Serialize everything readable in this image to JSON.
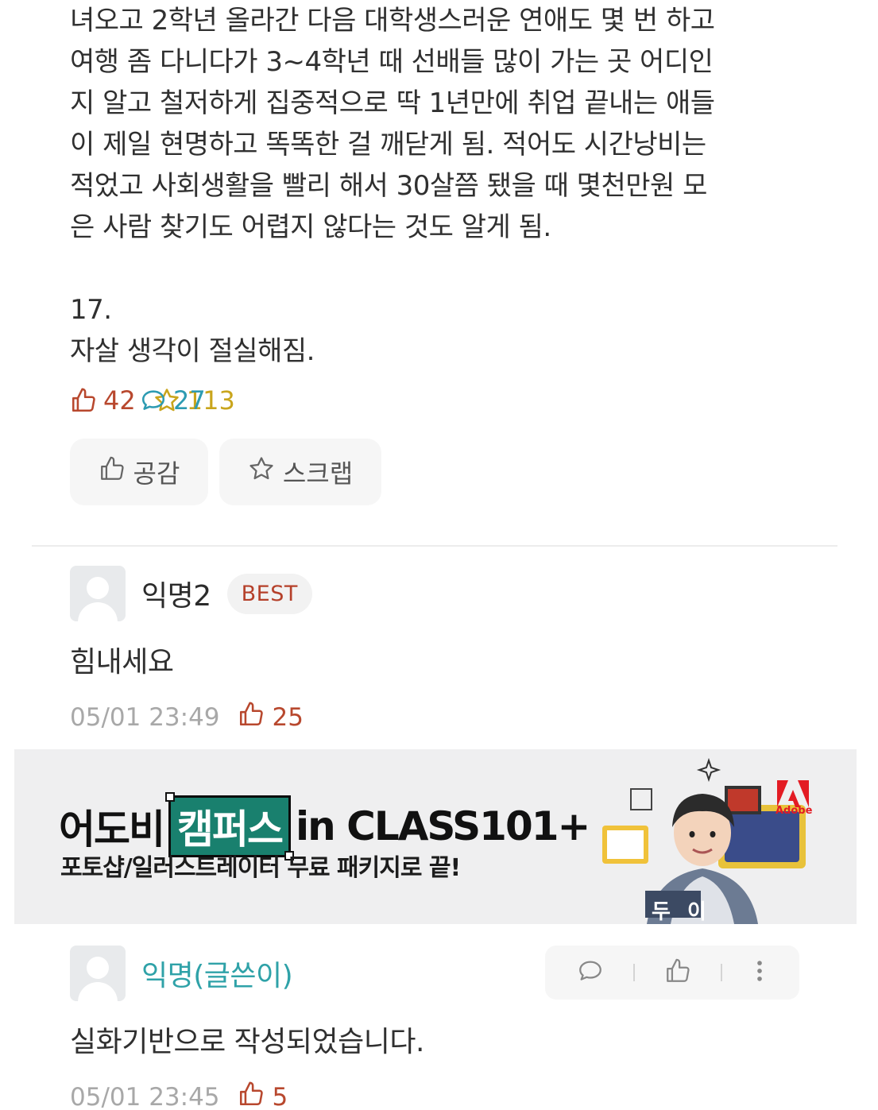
{
  "post": {
    "lines_top": [
      "녀오고 2학년 올라간 다음 대학생스러운 연애도 몇 번 하고",
      "여행 좀 다니다가 3~4학년 때 선배들 많이 가는 곳 어디인",
      "지 알고 철저하게 집중적으로 딱 1년만에 취업 끝내는 애들",
      "이 제일 현명하고 똑똑한 걸 깨닫게 됨. 적어도 시간낭비는",
      "적었고 사회생활을 빨리 해서 30살쯤 됐을 때 몇천만원 모",
      "은 사람 찾기도 어렵지 않다는 것도 알게 됨."
    ],
    "section_number": "17.",
    "section_text": "자살 생각이 절실해짐."
  },
  "stats": {
    "likes": "42",
    "comments": "27",
    "scraps": "113",
    "like_color": "#b8482e",
    "comment_color": "#2d9bb2",
    "scrap_color": "#c9a51c"
  },
  "actions": {
    "empathy_label": "공감",
    "scrap_label": "스크랩"
  },
  "comments": [
    {
      "nickname": "익명2",
      "badge": "BEST",
      "text": "힘내세요",
      "date": "05/01 23:49",
      "likes": "25"
    },
    {
      "nickname": "익명(글쓴이)",
      "text": "실화기반으로 작성되었습니다.",
      "date": "05/01 23:45",
      "likes": "5"
    }
  ],
  "ad": {
    "title_pre": "어도비",
    "title_highlight": "캠퍼스",
    "title_post": "in CLASS101+",
    "subtitle": "포토샵/일러스트레이터 무료 패키지로 끝!",
    "brand": "Adobe",
    "person_caption": "두 이",
    "highlight_color": "#19806e"
  }
}
